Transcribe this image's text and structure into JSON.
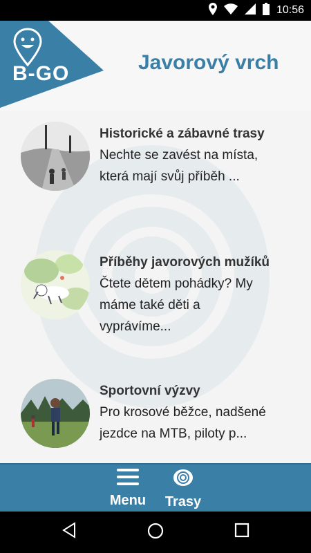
{
  "status_bar": {
    "time": "10:56"
  },
  "header": {
    "logo_text": "B-GO",
    "title": "Javorový vrch"
  },
  "items": [
    {
      "title": "Historické a zábavné trasy",
      "description": "Nechte se zavést na místa, která mají svůj příběh ..."
    },
    {
      "title": "Příběhy javorových mužíků",
      "description": "Čtete dětem pohádky? My máme také děti a vyprávíme..."
    },
    {
      "title": "Sportovní výzvy",
      "description": "Pro krosové běžce, nadšené jezdce na MTB, piloty p..."
    }
  ],
  "bottom_nav": {
    "menu_label": "Menu",
    "routes_label": "Trasy"
  },
  "colors": {
    "accent": "#3a7fa6",
    "status_bar": "#000000"
  }
}
